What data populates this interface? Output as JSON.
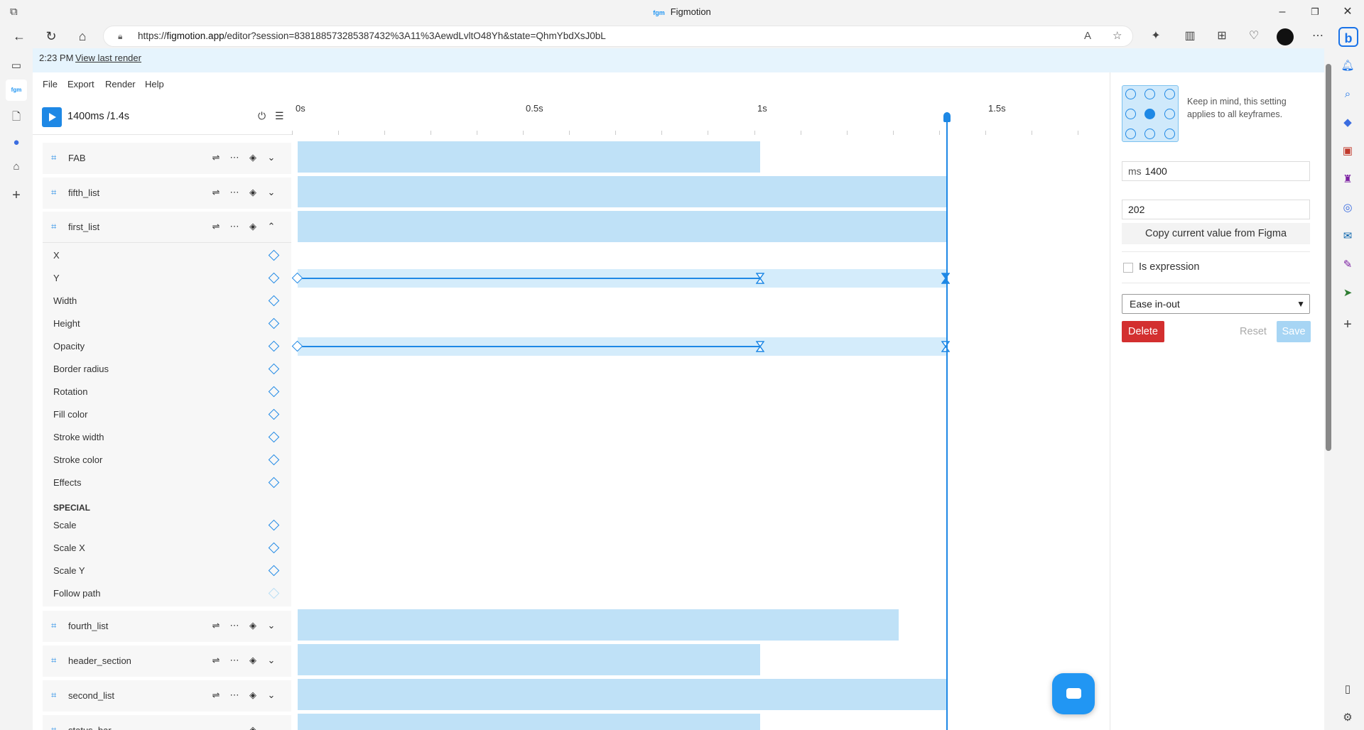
{
  "browser": {
    "window_title": "Figmotion",
    "logo_text": "fgm",
    "url_prefix": "https://",
    "url_domain": "figmotion.app",
    "url_rest": "/editor?session=838188573285387432%3A11%3AewdLvltO48Yh&state=QhmYbdXsJ0bL"
  },
  "banner": {
    "time": "2:23 PM",
    "link": "View last render"
  },
  "menu": [
    "File",
    "Export",
    "Render",
    "Help"
  ],
  "playback": {
    "timecode": "1400ms /1.4s"
  },
  "ruler": {
    "ticks": [
      "0s",
      "0.5s",
      "1s",
      "1.5s"
    ]
  },
  "layers": {
    "top": [
      {
        "name": "FAB"
      },
      {
        "name": "fifth_list"
      },
      {
        "name": "first_list"
      }
    ],
    "properties": [
      "X",
      "Y",
      "Width",
      "Height",
      "Opacity",
      "Border radius",
      "Rotation",
      "Fill color",
      "Stroke width",
      "Stroke color",
      "Effects"
    ],
    "special_label": "SPECIAL",
    "special_properties": [
      "Scale",
      "Scale X",
      "Scale Y",
      "Follow path"
    ],
    "bottom": [
      {
        "name": "fourth_list"
      },
      {
        "name": "header_section"
      },
      {
        "name": "second_list"
      },
      {
        "name": "status_bar"
      }
    ]
  },
  "panel": {
    "note": "Keep in mind, this setting applies to all keyframes.",
    "time_unit": "ms",
    "time_value": "1400",
    "value": "202",
    "copy_button": "Copy current value from Figma",
    "expression_label": "Is expression",
    "easing": "Ease in-out",
    "delete": "Delete",
    "reset": "Reset",
    "save": "Save"
  },
  "colors": {
    "accent": "#1e88e5",
    "bar": "#bfe1f7",
    "danger": "#d32f2f"
  }
}
